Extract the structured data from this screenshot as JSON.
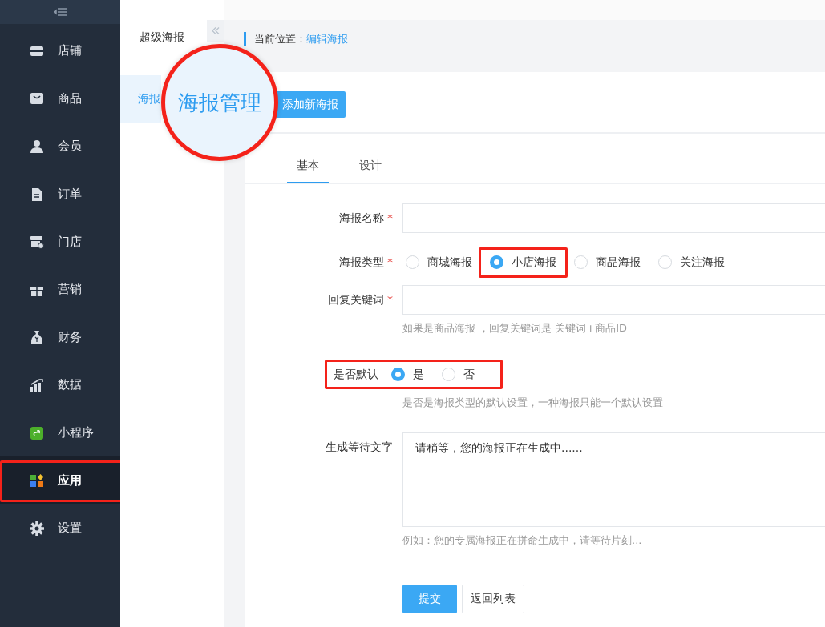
{
  "sidebar": {
    "items": [
      {
        "label": "店铺",
        "selected": false,
        "highlighted": false
      },
      {
        "label": "商品",
        "selected": false,
        "highlighted": false
      },
      {
        "label": "会员",
        "selected": false,
        "highlighted": false
      },
      {
        "label": "订单",
        "selected": false,
        "highlighted": false
      },
      {
        "label": "门店",
        "selected": false,
        "highlighted": false
      },
      {
        "label": "营销",
        "selected": false,
        "highlighted": false
      },
      {
        "label": "财务",
        "selected": false,
        "highlighted": false
      },
      {
        "label": "数据",
        "selected": false,
        "highlighted": false
      },
      {
        "label": "小程序",
        "selected": false,
        "highlighted": false
      },
      {
        "label": "应用",
        "selected": true,
        "highlighted": true
      },
      {
        "label": "设置",
        "selected": false,
        "highlighted": false
      }
    ]
  },
  "submenu": {
    "title": "超级海报",
    "items": [
      {
        "label": "海报",
        "selected": true
      }
    ]
  },
  "magnifier": {
    "label": "海报管理"
  },
  "breadcrumb": {
    "label": "当前位置：",
    "current": "编辑海报"
  },
  "add_button": "添加新海报",
  "tabs": [
    {
      "label": "基本",
      "selected": true
    },
    {
      "label": "设计",
      "selected": false
    }
  ],
  "form": [
    {
      "kind": "input",
      "label": "海报名称",
      "required_mark": "*"
    },
    {
      "kind": "radio",
      "label": "海报类型",
      "required_mark": "*",
      "options": [
        {
          "label": "商城海报",
          "selected": false
        },
        {
          "label": "小店海报",
          "selected": true,
          "highlighted": true
        },
        {
          "label": "商品海报",
          "selected": false
        },
        {
          "label": "关注海报",
          "selected": false
        }
      ]
    },
    {
      "kind": "input",
      "label": "回复关键词",
      "required_mark": "*",
      "help": "如果是商品海报 ，回复关键词是 关键词+商品ID"
    },
    {
      "kind": "radio",
      "label": "是否默认",
      "highlighted": true,
      "options": [
        {
          "label": "是",
          "selected": true
        },
        {
          "label": "否",
          "selected": false
        }
      ],
      "help": "是否是海报类型的默认设置，一种海报只能一个默认设置"
    },
    {
      "kind": "textarea",
      "label": "生成等待文字",
      "value": "请稍等，您的海报正在生成中......",
      "help": "例如：您的专属海报正在拼命生成中，请等待片刻..."
    }
  ],
  "buttons": [
    {
      "label": "提交",
      "kind": "primary"
    },
    {
      "label": "返回列表",
      "kind": "default"
    }
  ]
}
